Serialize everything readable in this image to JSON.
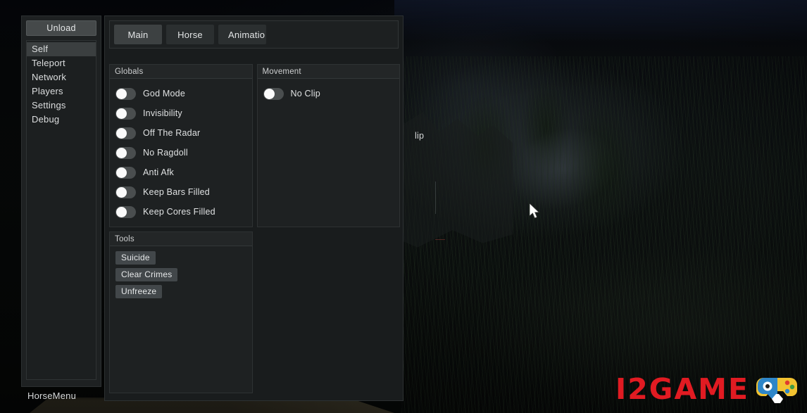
{
  "window": {
    "title": "HorseMenu",
    "unload_label": "Unload"
  },
  "sidebar": {
    "items": [
      {
        "label": "Self",
        "active": true
      },
      {
        "label": "Teleport",
        "active": false
      },
      {
        "label": "Network",
        "active": false
      },
      {
        "label": "Players",
        "active": false
      },
      {
        "label": "Settings",
        "active": false
      },
      {
        "label": "Debug",
        "active": false
      }
    ]
  },
  "tabs": [
    {
      "label": "Main",
      "active": true
    },
    {
      "label": "Horse",
      "active": false
    },
    {
      "label": "Animations",
      "active": false
    }
  ],
  "panels": {
    "globals": {
      "header": "Globals",
      "toggles": [
        {
          "label": "God Mode",
          "on": false
        },
        {
          "label": "Invisibility",
          "on": false
        },
        {
          "label": "Off The Radar",
          "on": false
        },
        {
          "label": "No Ragdoll",
          "on": false
        },
        {
          "label": "Anti Afk",
          "on": false
        },
        {
          "label": "Keep Bars Filled",
          "on": false
        },
        {
          "label": "Keep Cores Filled",
          "on": false
        }
      ]
    },
    "tools": {
      "header": "Tools",
      "buttons": [
        {
          "label": "Suicide"
        },
        {
          "label": "Clear Crimes"
        },
        {
          "label": "Unfreeze"
        }
      ]
    },
    "movement": {
      "header": "Movement",
      "toggles": [
        {
          "label": "No Clip",
          "on": false
        }
      ]
    }
  },
  "artifact": {
    "ghost_text": "lip"
  },
  "watermark": {
    "text": "I2GAME",
    "icon": "gamepad-icon",
    "color": "#e11b22"
  },
  "colors": {
    "panel_bg": "#1e2122",
    "content_bg": "#191c1d",
    "border": "#2e3233",
    "text": "#dfe1e2",
    "active_nav": "#3b3f40",
    "active_tab": "#3d4142",
    "toggle_track": "#4a4e4f",
    "toggle_knob": "#fbfbfb",
    "button_bg": "#42474a"
  }
}
